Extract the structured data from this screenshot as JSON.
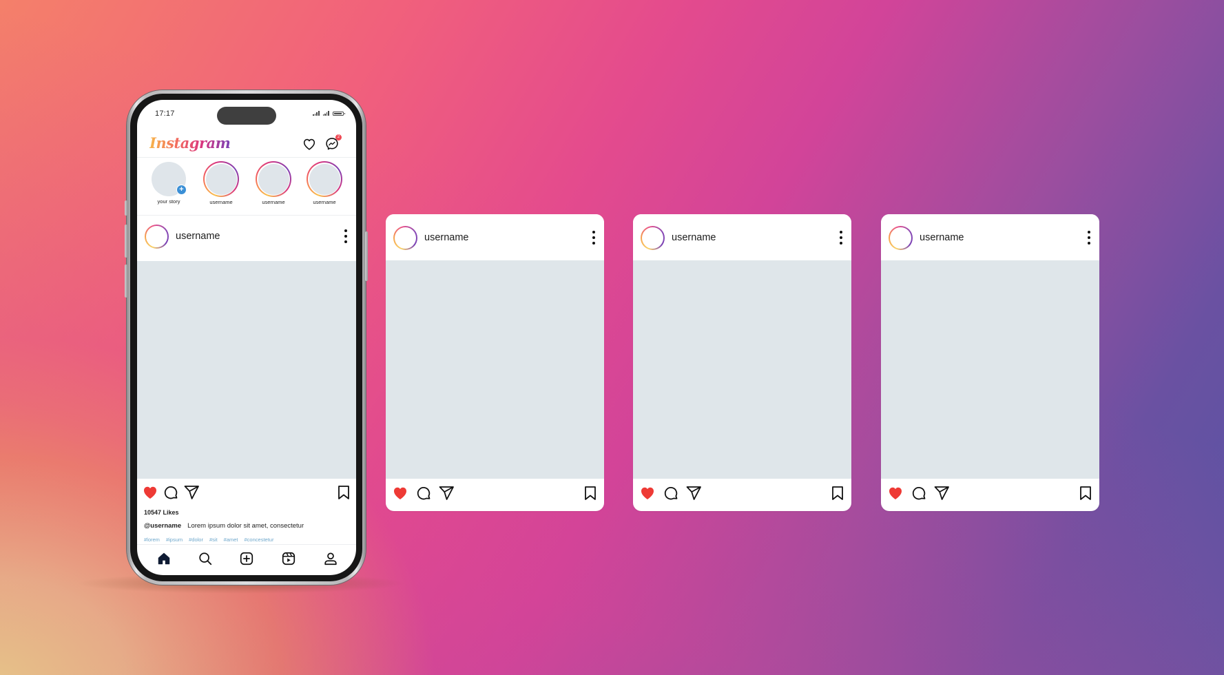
{
  "background": {
    "gradient_colors": [
      "#f7dc82",
      "#f4806a",
      "#f1607c",
      "#d24499",
      "#9a4e9f",
      "#5655a4"
    ]
  },
  "phone": {
    "status_bar": {
      "time": "17:17",
      "battery_icon": "battery-icon",
      "signal_icon": "signal-icon"
    },
    "header": {
      "logo": "Instagram",
      "icons": [
        "heart-icon",
        "messenger-icon"
      ],
      "messenger_badge_count": "2"
    },
    "stories": [
      {
        "label": "your story",
        "own": true
      },
      {
        "label": "username",
        "own": false
      },
      {
        "label": "username",
        "own": false
      },
      {
        "label": "username",
        "own": false
      }
    ],
    "post": {
      "username": "username",
      "likes": "10547 Likes",
      "caption_user": "@username",
      "caption_text": "Lorem ipsum dolor sit amet, consectetur",
      "hashtags": [
        "#lorem",
        "#ipsum",
        "#dolor",
        "#sit",
        "#amet",
        "#concestetur"
      ],
      "liked": true
    },
    "bottom_nav": [
      "home-icon",
      "search-icon",
      "add-post-icon",
      "reels-icon",
      "profile-icon"
    ]
  },
  "cards": [
    {
      "username": "username",
      "liked": true
    },
    {
      "username": "username",
      "liked": true
    },
    {
      "username": "username",
      "liked": true
    }
  ],
  "colors": {
    "like_red": "#ee3a35",
    "image_placeholder": "#dfe6ea",
    "hashtag_blue": "#6fa8cc",
    "story_plus_blue": "#3a8fd6"
  }
}
